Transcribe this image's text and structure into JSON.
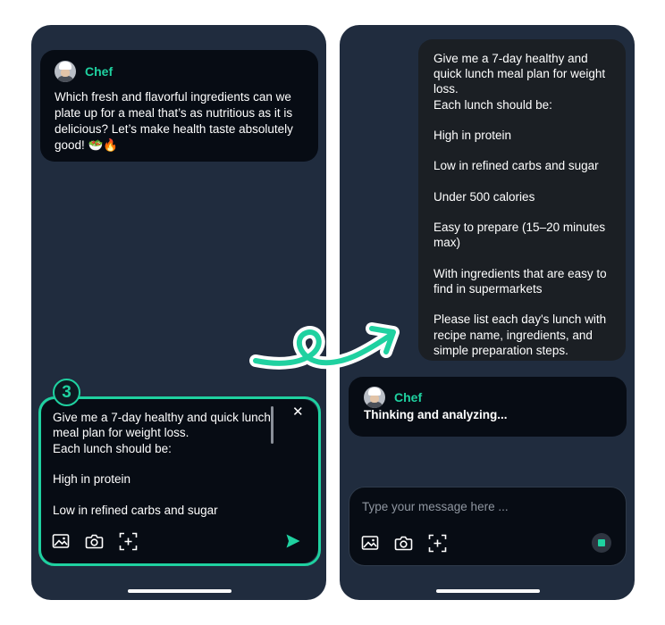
{
  "left_phone": {
    "bot": {
      "name": "Chef",
      "message": "Which fresh and flavorful ingredients can we plate up for a meal that’s as nutritious as it is delicious? Let’s make health taste absolutely good! 🥗🔥"
    },
    "composer": {
      "text": "Give me a 7-day healthy and quick lunch meal plan for weight loss.\nEach lunch should be:\n\nHigh in protein\n\nLow in refined carbs and sugar",
      "close_label": "✕"
    },
    "step_label": "3"
  },
  "right_phone": {
    "user_message_lines": [
      "Give me a 7-day healthy and",
      "quick lunch meal plan for weight",
      "loss.",
      "Each lunch should be:",
      "",
      "High in protein",
      "",
      "Low in refined carbs and sugar",
      "",
      "Under 500 calories",
      "",
      "Easy to prepare (15–20 minutes",
      "max)",
      "",
      "With ingredients that are easy to",
      "find in supermarkets",
      "",
      "Please list each day's lunch with",
      "recipe name, ingredients, and",
      "simple preparation steps."
    ],
    "bot": {
      "name": "Chef",
      "status": "Thinking and analyzing..."
    },
    "composer": {
      "placeholder": "Type your message here ..."
    }
  },
  "colors": {
    "accent": "#1fd1a0",
    "phone_bg": "#202c3e",
    "bubble_bg": "#070c14",
    "user_bubble_bg": "#1b1f24"
  },
  "icons": [
    "image-icon",
    "camera-icon",
    "add-frame-icon",
    "send-icon",
    "stop-icon",
    "close-icon",
    "curly-arrow-icon"
  ]
}
